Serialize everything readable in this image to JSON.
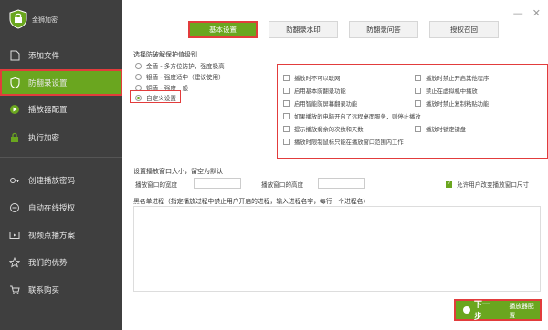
{
  "app": {
    "name": "金狮加密"
  },
  "window": {
    "minimize_icon": "minimize-icon",
    "close_icon": "close-icon"
  },
  "sidebar": {
    "items": [
      {
        "label": "添加文件",
        "icon": "file-icon"
      },
      {
        "label": "防翻录设置",
        "icon": "shield-icon",
        "active": true
      },
      {
        "label": "播放器配置",
        "icon": "player-icon"
      },
      {
        "label": "执行加密",
        "icon": "lock-icon"
      },
      {
        "label": "创建播放密码",
        "icon": "key-icon"
      },
      {
        "label": "自动在线授权",
        "icon": "link-icon"
      },
      {
        "label": "视频点播方案",
        "icon": "video-icon"
      },
      {
        "label": "我们的优势",
        "icon": "star-icon"
      },
      {
        "label": "联系购买",
        "icon": "cart-icon"
      }
    ]
  },
  "tabs": [
    {
      "label": "基本设置",
      "active": true
    },
    {
      "label": "防翻录水印"
    },
    {
      "label": "防翻录问答"
    },
    {
      "label": "授权召回"
    }
  ],
  "protection": {
    "label": "选择防破解保护值级别",
    "levels": [
      {
        "label": "金盾 - 多方位防护，强度极高",
        "selected": false
      },
      {
        "label": "银盾 - 强度适中（建议使用）",
        "selected": false
      },
      {
        "label": "铜盾 - 强度一般",
        "selected": false
      },
      {
        "label": "自定义设置",
        "selected": true
      }
    ]
  },
  "options": [
    {
      "label": "播放时不可以联网",
      "checked": false
    },
    {
      "label": "播放时禁止开启其他程序",
      "checked": false
    },
    {
      "label": "启用基本防翻录功能",
      "checked": false
    },
    {
      "label": "禁止在虚拟机中播放",
      "checked": false
    },
    {
      "label": "启用智能防屏幕翻录功能",
      "checked": false
    },
    {
      "label": "播放时禁止复制粘贴功能",
      "checked": false
    },
    {
      "label": "如果播放的电脑开启了远程桌面服务，则停止播放",
      "checked": false
    },
    {
      "label": "提示播放剩余的次数和天数",
      "checked": false
    },
    {
      "label": "播放时锁定键盘",
      "checked": false
    },
    {
      "label": "播放时限制鼠标只能在播放窗口范围内工作",
      "checked": false
    }
  ],
  "window_size": {
    "label": "设置播放窗口大小，留空为默认",
    "width_label": "播放窗口的宽度",
    "width_value": "0",
    "height_label": "播放窗口的高度",
    "height_value": "0",
    "allow_resize_label": "允许用户改变播放窗口尺寸",
    "allow_resize_checked": true
  },
  "whitelist": {
    "label": "黑名单进程（指定播放过程中禁止用户开启的进程，输入进程名字，每行一个进程名）",
    "value": ""
  },
  "footer": {
    "next_label": "下一步",
    "config_label": "播放器配置"
  },
  "colors": {
    "sidebar": "#3f3f3f",
    "accent": "#6aa61f",
    "highlight": "#e23c3c"
  }
}
